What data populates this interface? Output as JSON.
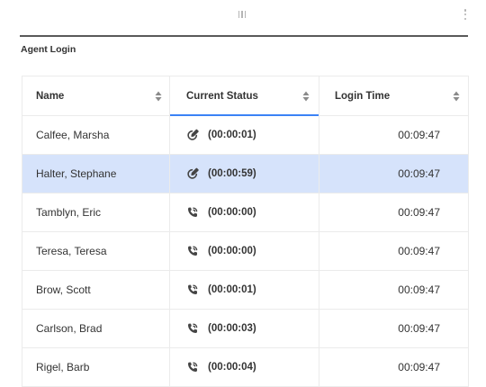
{
  "widget": {
    "title": "Agent Login"
  },
  "table": {
    "columns": [
      {
        "label": "Name"
      },
      {
        "label": "Current Status"
      },
      {
        "label": "Login Time"
      }
    ],
    "rows": [
      {
        "name": "Calfee, Marsha",
        "status_icon": "edit-pencil-circle-icon",
        "status_time": "(00:00:01)",
        "login_time": "00:09:47"
      },
      {
        "name": "Halter, Stephane",
        "status_icon": "edit-pencil-circle-icon",
        "status_time": "(00:00:59)",
        "login_time": "00:09:47"
      },
      {
        "name": "Tamblyn, Eric",
        "status_icon": "phone-call-icon",
        "status_time": "(00:00:00)",
        "login_time": "00:09:47"
      },
      {
        "name": "Teresa, Teresa",
        "status_icon": "phone-call-icon",
        "status_time": "(00:00:00)",
        "login_time": "00:09:47"
      },
      {
        "name": "Brow, Scott",
        "status_icon": "phone-call-icon",
        "status_time": "(00:00:01)",
        "login_time": "00:09:47"
      },
      {
        "name": "Carlson, Brad",
        "status_icon": "phone-call-icon",
        "status_time": "(00:00:03)",
        "login_time": "00:09:47"
      },
      {
        "name": "Rigel, Barb",
        "status_icon": "phone-call-icon",
        "status_time": "(00:00:04)",
        "login_time": "00:09:47"
      }
    ],
    "selected_row": "Halter, Stephane",
    "active_sort_column": "Current Status"
  },
  "colors": {
    "selected_row": "#d6e3fb",
    "active_column_underline": "#3b82f6",
    "title_rule": "#5a5a5a"
  }
}
